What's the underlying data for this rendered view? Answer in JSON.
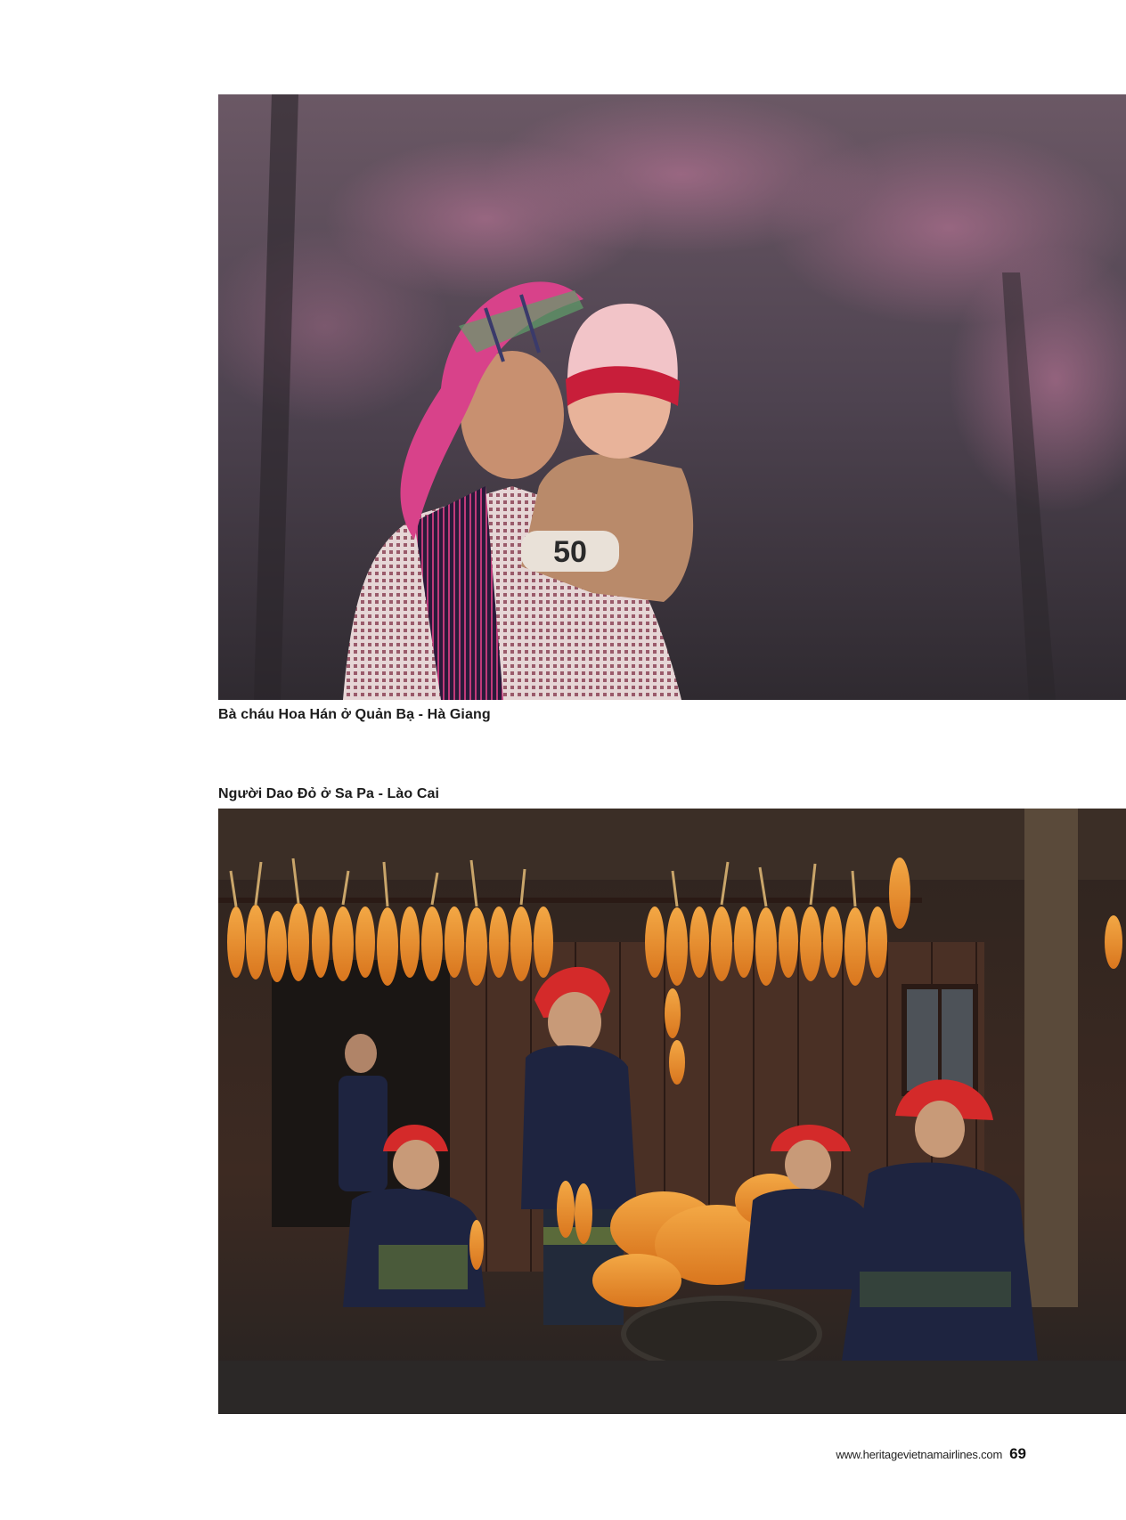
{
  "photos": {
    "top": {
      "caption": "Bà cháu Hoa Hán ở Quản Bạ - Hà Giang",
      "jersey_number": "50"
    },
    "bottom": {
      "caption": "Người Dao Đỏ ở Sa Pa - Lào Cai"
    }
  },
  "footer": {
    "url": "www.heritagevietnamairlines.com",
    "page_number": "69"
  },
  "colors": {
    "blossom_background": "#5a4a55",
    "scarf_pink": "#d8428a",
    "hat_red": "#c81e3a",
    "corn_orange": "#e8892a",
    "wood_dark": "#3a2a22",
    "indigo_clothing": "#1e2440",
    "headscarf_red": "#d42a2a"
  }
}
